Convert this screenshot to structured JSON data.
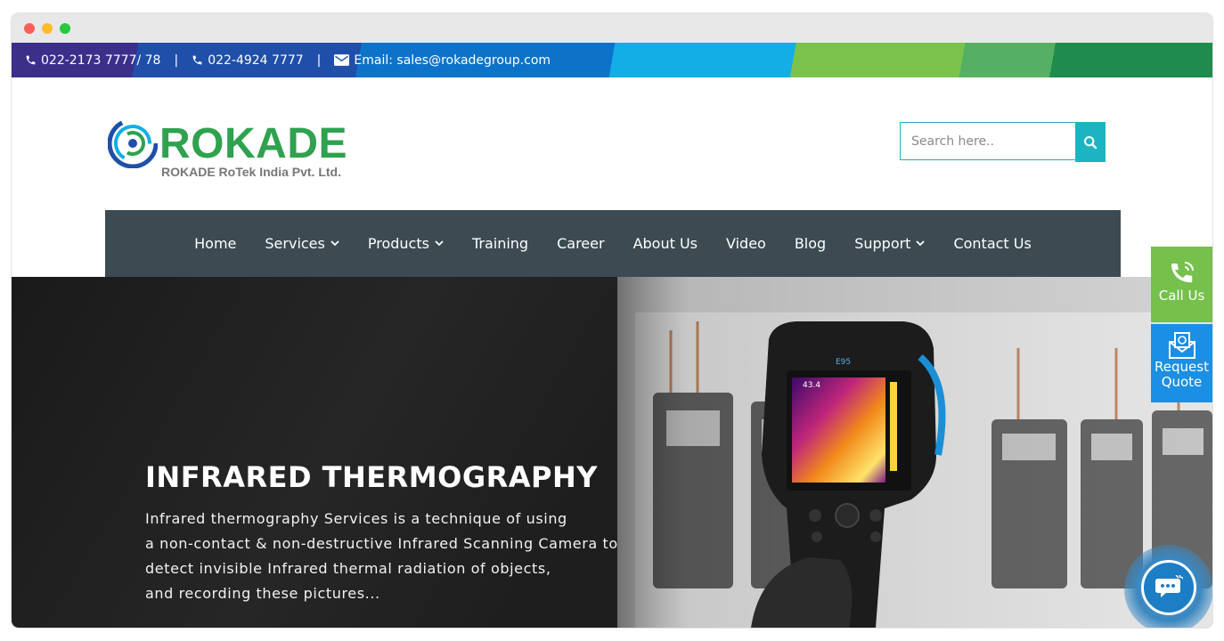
{
  "window": {
    "controls": [
      "close",
      "minimize",
      "maximize"
    ]
  },
  "topbar": {
    "phone1": "022-2173 7777/ 78",
    "phone2": "022-4924 7777",
    "separator": "|",
    "email": "Email: sales@rokadegroup.com",
    "phone_icon": "phone-icon",
    "email_icon": "envelope-icon"
  },
  "logo": {
    "word": "ROKADE",
    "subtitle": "ROKADE RoTek India Pvt. Ltd.",
    "brand_color": "#2fa24f"
  },
  "search": {
    "placeholder": "Search here..",
    "value": "",
    "icon": "search-icon",
    "accent": "#1db4c2"
  },
  "nav": {
    "items": [
      {
        "label": "Home",
        "dropdown": false
      },
      {
        "label": "Services",
        "dropdown": true
      },
      {
        "label": "Products",
        "dropdown": true
      },
      {
        "label": "Training",
        "dropdown": false
      },
      {
        "label": "Career",
        "dropdown": false
      },
      {
        "label": "About Us",
        "dropdown": false
      },
      {
        "label": "Video",
        "dropdown": false
      },
      {
        "label": "Blog",
        "dropdown": false
      },
      {
        "label": "Support",
        "dropdown": true
      },
      {
        "label": "Contact Us",
        "dropdown": false
      }
    ],
    "background": "#3c4a52"
  },
  "hero": {
    "title": "INFRARED THERMOGRAPHY",
    "description_lines": [
      "Infrared thermography Services is a technique of using",
      "a non-contact & non-destructive Infrared Scanning Camera to",
      "detect invisible Infrared thermal radiation of objects,",
      "and recording these pictures..."
    ],
    "camera": {
      "model": "E95",
      "temperature": "43.4"
    }
  },
  "side": {
    "call_label": "Call Us",
    "quote_line1": "Request",
    "quote_line2": "Quote",
    "call_color": "#76c04c",
    "quote_color": "#1b8fe3"
  },
  "chat": {
    "icon": "chat-bubble-icon"
  }
}
